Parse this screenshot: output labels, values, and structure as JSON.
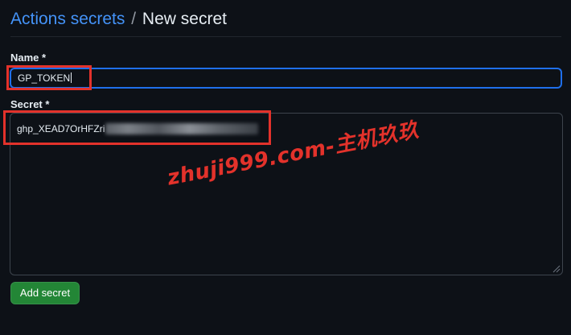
{
  "header": {
    "breadcrumb_link": "Actions secrets",
    "separator": "/",
    "current": "New secret"
  },
  "form": {
    "name_label": "Name *",
    "name_value": "GP_TOKEN",
    "secret_label": "Secret *",
    "secret_value_visible": "ghp_XEAD7OrHFZri",
    "submit_label": "Add secret"
  },
  "watermark": {
    "text": "zhuji999.com-主机玖玖"
  },
  "colors": {
    "background": "#0d1117",
    "link": "#4493f8",
    "focus_border": "#1f6feb",
    "button": "#238636",
    "annotation": "#e3322b"
  }
}
